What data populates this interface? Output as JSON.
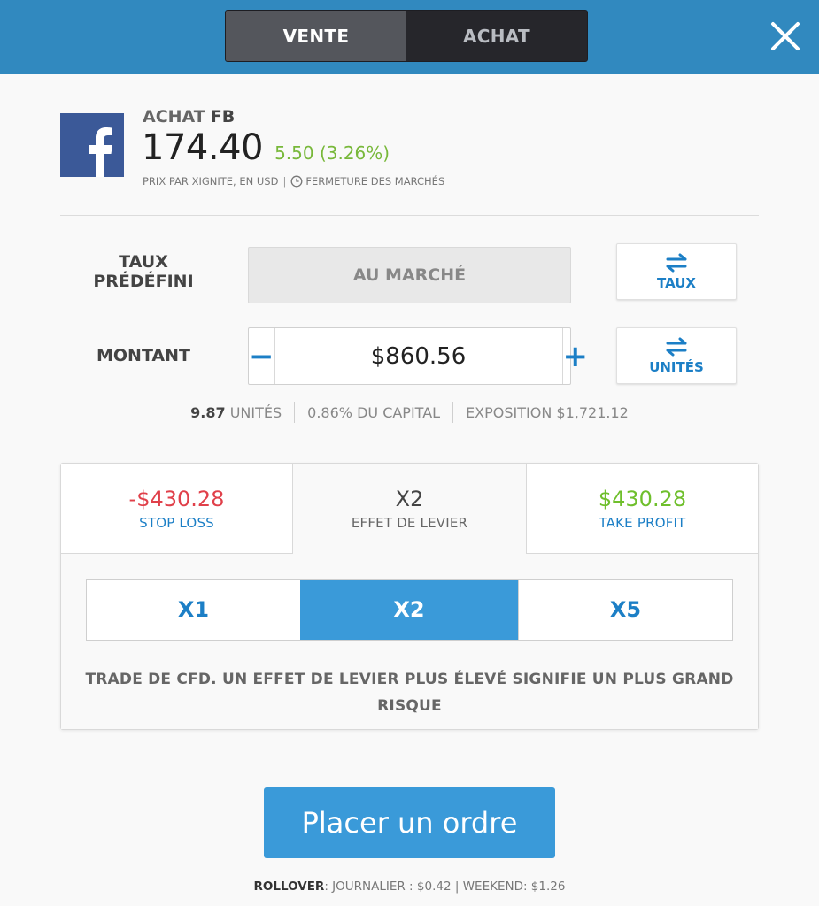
{
  "header": {
    "tabs": [
      {
        "label": "VENTE",
        "active": true
      },
      {
        "label": "ACHAT",
        "active": false
      }
    ],
    "accent": "#3189bf",
    "close_icon": "close-icon"
  },
  "instrument": {
    "action": "ACHAT",
    "symbol": "FB",
    "logo_icon": "facebook-logo",
    "price": "174.40",
    "change": "5.50 (3.26%)",
    "source": "PRIX PAR XIGNITE, EN USD",
    "market_status": "FERMETURE DES MARCHÉS"
  },
  "rate": {
    "label_line1": "TAUX",
    "label_line2": "PRÉDÉFINI",
    "value": "AU MARCHÉ",
    "switch_label": "TAUX"
  },
  "amount": {
    "label": "MONTANT",
    "minus": "−",
    "plus": "+",
    "value": "$860.56",
    "switch_label": "UNITÉS"
  },
  "stats": {
    "units_value": "9.87",
    "units_label": "UNITÉS",
    "capital": "0.86% DU CAPITAL",
    "exposure_label": "EXPOSITION",
    "exposure_value": "$1,721.12"
  },
  "panel": {
    "stop_loss": {
      "value": "-$430.28",
      "label": "STOP LOSS"
    },
    "leverage": {
      "value": "X2",
      "label": "EFFET DE LEVIER"
    },
    "take_profit": {
      "value": "$430.28",
      "label": "TAKE PROFIT"
    },
    "leverage_options": [
      "X1",
      "X2",
      "X5"
    ],
    "selected_leverage": "X2",
    "warning": "TRADE DE CFD. UN EFFET DE LEVIER PLUS ÉLEVÉ SIGNIFIE UN PLUS GRAND RISQUE",
    "colors": {
      "loss": "#e0404a",
      "profit": "#6fbf2c",
      "link": "#1c7fc6",
      "selected": "#3a9ad9"
    }
  },
  "order": {
    "button_label": "Placer un ordre"
  },
  "rollover": {
    "label": "ROLLOVER",
    "daily": ": JOURNALIER : $0.42",
    "weekend": "WEEKEND: $1.26"
  }
}
